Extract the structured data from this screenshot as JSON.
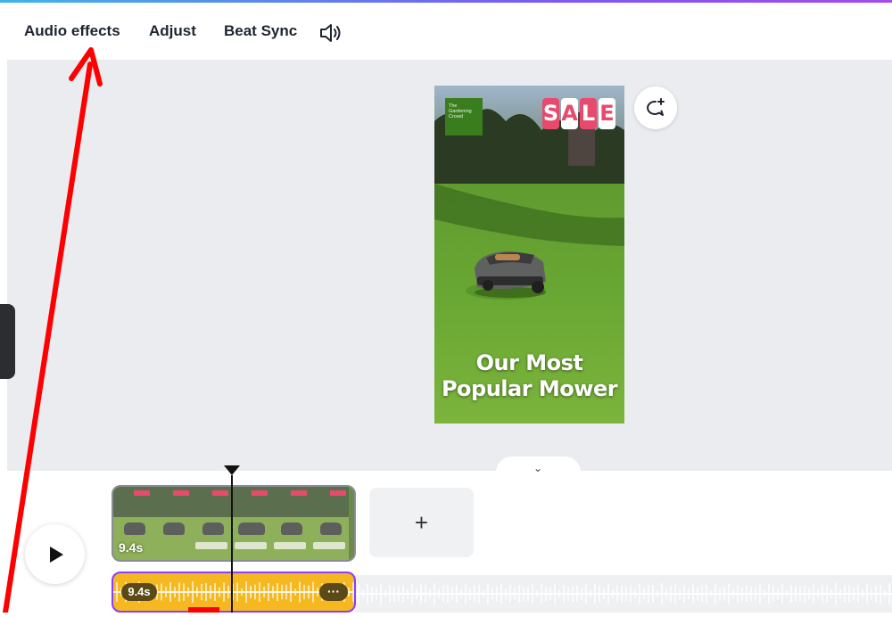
{
  "toolbar": {
    "audio_effects": "Audio effects",
    "adjust": "Adjust",
    "beat_sync": "Beat Sync",
    "volume_icon": "speaker-icon"
  },
  "design": {
    "logo_text": "The Gardening Crowd",
    "sale_letters": [
      "S",
      "A",
      "L",
      "E"
    ],
    "headline_line1": "Our Most",
    "headline_line2": "Popular Mower"
  },
  "timeline": {
    "video_duration": "9.4s",
    "audio_duration": "9.4s",
    "add_label": "+",
    "more_label": "···"
  },
  "colors": {
    "accent_purple": "#8b3dff",
    "audio_track": "#f5b820",
    "sale_pink": "#e74a6c",
    "annotation_red": "#ff0000"
  }
}
